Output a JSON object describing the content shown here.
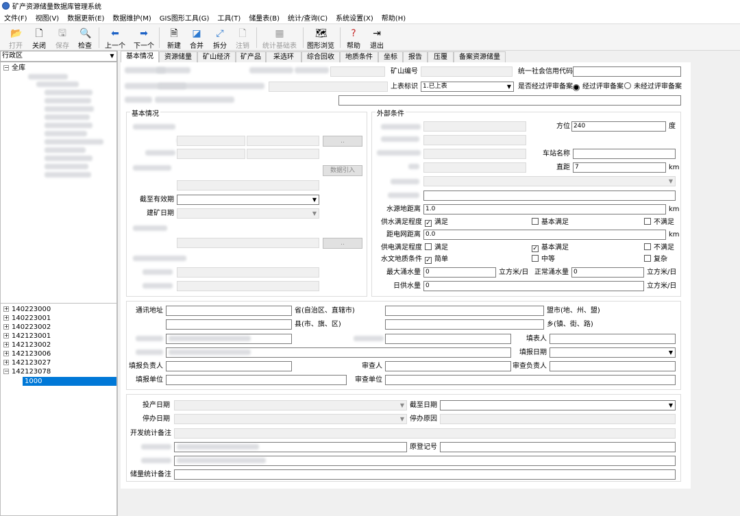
{
  "window": {
    "title": "矿产资源储量数据库管理系统"
  },
  "menu": [
    "文件(F)",
    "视图(V)",
    "数据更新(E)",
    "数据维护(M)",
    "GIS图形工具(G)",
    "工具(T)",
    "储量表(B)",
    "统计/查询(C)",
    "系统设置(X)",
    "帮助(H)"
  ],
  "toolbar": {
    "open": "打开",
    "close": "关闭",
    "save": "保存",
    "check": "检查",
    "prev": "上一个",
    "next": "下一个",
    "new": "新建",
    "merge": "合并",
    "split": "拆分",
    "cancel": "注销",
    "stat": "统计基础表",
    "graph": "图形浏览",
    "help": "帮助",
    "exit": "退出"
  },
  "left": {
    "combo": "行政区",
    "root": "全库",
    "codes": [
      "140223000",
      "140223001",
      "140223002",
      "142123001",
      "142123002",
      "142123006",
      "142123027",
      "142123078"
    ],
    "selected": "1000"
  },
  "tabs": [
    "基本情况",
    "资源储量",
    "矿山经济",
    "矿产品",
    "采选环",
    "综合回收",
    "地质条件",
    "坐标",
    "报告",
    "压覆",
    "备案资源储量"
  ],
  "header": {
    "mine_no_label": "矿山编号",
    "credit_code_label": "统一社会信用代码",
    "report_label": "上表标识",
    "report_value": "1.已上表",
    "reviewed_label": "是否经过评审备案",
    "opt_reviewed": "经过评审备案",
    "opt_not_reviewed": "未经过评审备案"
  },
  "basic": {
    "title": "基本情况",
    "expiry_label": "截至有效期",
    "build_label": "建矿日期",
    "btn_dots": "..",
    "btn_import": "数据引入"
  },
  "external": {
    "title": "外部条件",
    "bearing_label": "方位",
    "bearing_value": "240",
    "bearing_unit": "度",
    "station_label": "车站名称",
    "dist_label": "直距",
    "dist_value": "7",
    "km": "km",
    "water_dist_label": "水源地距离",
    "water_dist_value": "1.0",
    "water_supply_label": "供水满足程度",
    "satisfied": "满足",
    "basic_satisfied": "基本满足",
    "not_satisfied": "不满足",
    "grid_label": "距电网距离",
    "grid_value": "0.0",
    "power_label": "供电满足程度",
    "hydro_label": "水文地质条件",
    "simple": "简单",
    "medium": "中等",
    "complex": "复杂",
    "max_water_label": "最大涌水量",
    "max_water_value": "0",
    "normal_water_label": "正常涌水量",
    "normal_water_value": "0",
    "water_unit": "立方米/日",
    "daily_label": "日供水量",
    "daily_value": "0"
  },
  "contact": {
    "addr_label": "通讯地址",
    "province": "省(自治区、直辖市)",
    "city": "盟市(地、州、盟)",
    "county": "县(市、旗、区)",
    "town": "乡(镇、街、路)",
    "filler": "填表人",
    "fill_date": "填报日期",
    "fill_resp": "填报负责人",
    "reviewer": "审查人",
    "review_resp": "审查负责人",
    "fill_unit": "填报单位",
    "review_unit": "审查单位"
  },
  "dev": {
    "start": "投产日期",
    "until": "截至日期",
    "stop": "停办日期",
    "reason": "停办原因",
    "note": "开发统计备注",
    "orig": "原登记号",
    "reserve_note": "储量统计备注"
  }
}
